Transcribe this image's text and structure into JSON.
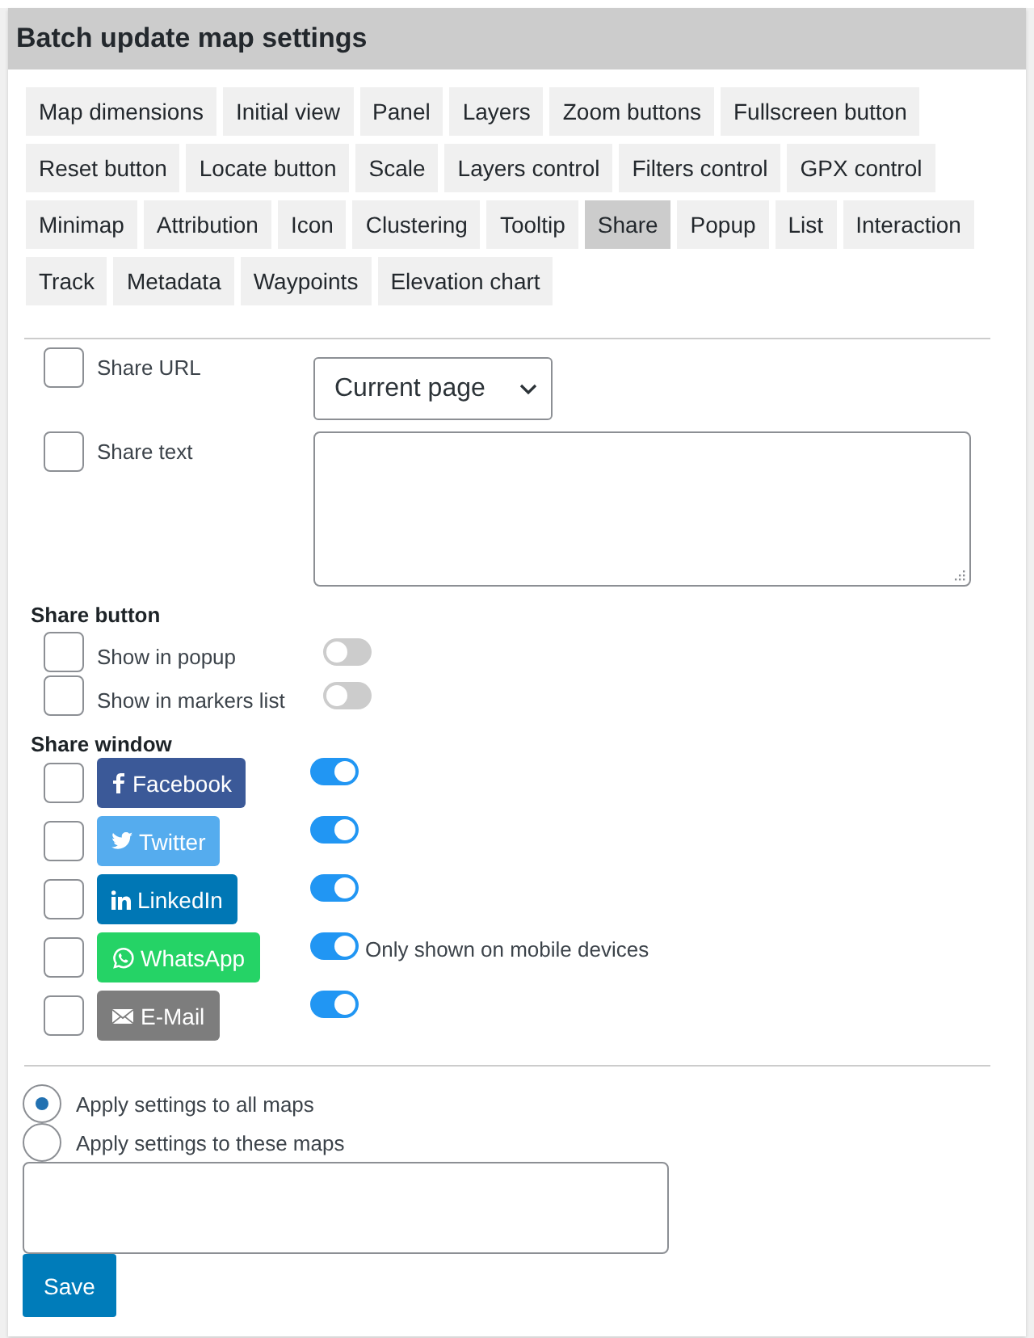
{
  "panel": {
    "title": "Batch update map settings"
  },
  "tabs": [
    {
      "label": "Map dimensions",
      "selected": false
    },
    {
      "label": "Initial view",
      "selected": false
    },
    {
      "label": "Panel",
      "selected": false
    },
    {
      "label": "Layers",
      "selected": false
    },
    {
      "label": "Zoom buttons",
      "selected": false
    },
    {
      "label": "Fullscreen button",
      "selected": false
    },
    {
      "label": "Reset button",
      "selected": false
    },
    {
      "label": "Locate button",
      "selected": false
    },
    {
      "label": "Scale",
      "selected": false
    },
    {
      "label": "Layers control",
      "selected": false
    },
    {
      "label": "Filters control",
      "selected": false
    },
    {
      "label": "GPX control",
      "selected": false
    },
    {
      "label": "Minimap",
      "selected": false
    },
    {
      "label": "Attribution",
      "selected": false
    },
    {
      "label": "Icon",
      "selected": false
    },
    {
      "label": "Clustering",
      "selected": false
    },
    {
      "label": "Tooltip",
      "selected": false
    },
    {
      "label": "Share",
      "selected": true
    },
    {
      "label": "Popup",
      "selected": false
    },
    {
      "label": "List",
      "selected": false
    },
    {
      "label": "Interaction",
      "selected": false
    },
    {
      "label": "Track",
      "selected": false
    },
    {
      "label": "Metadata",
      "selected": false
    },
    {
      "label": "Waypoints",
      "selected": false
    },
    {
      "label": "Elevation chart",
      "selected": false
    }
  ],
  "share_url": {
    "label": "Share URL",
    "checked": false,
    "value": "Current page"
  },
  "share_text": {
    "label": "Share text",
    "checked": false
  },
  "share_button": {
    "heading": "Share button",
    "rows": [
      {
        "label": "Show in popup",
        "checked": false,
        "on": false
      },
      {
        "label": "Show in markers list",
        "checked": false,
        "on": false
      }
    ]
  },
  "share_window": {
    "heading": "Share window",
    "rows": [
      {
        "kind": "facebook",
        "label": "Facebook",
        "color": "#3b5998",
        "checked": false,
        "on": true
      },
      {
        "kind": "twitter",
        "label": "Twitter",
        "color": "#55acee",
        "checked": false,
        "on": true
      },
      {
        "kind": "linkedin",
        "label": "LinkedIn",
        "color": "#0077b5",
        "checked": false,
        "on": true
      },
      {
        "kind": "whatsapp",
        "label": "WhatsApp",
        "color": "#25d366",
        "checked": false,
        "on": true,
        "note": "Only shown on mobile devices"
      },
      {
        "kind": "email",
        "label": "E-Mail",
        "color": "#7d7d7d",
        "checked": false,
        "on": true
      }
    ]
  },
  "apply": [
    {
      "label": "Apply settings to all maps",
      "selected": true
    },
    {
      "label": "Apply settings to these maps",
      "selected": false
    }
  ],
  "save": "Save"
}
